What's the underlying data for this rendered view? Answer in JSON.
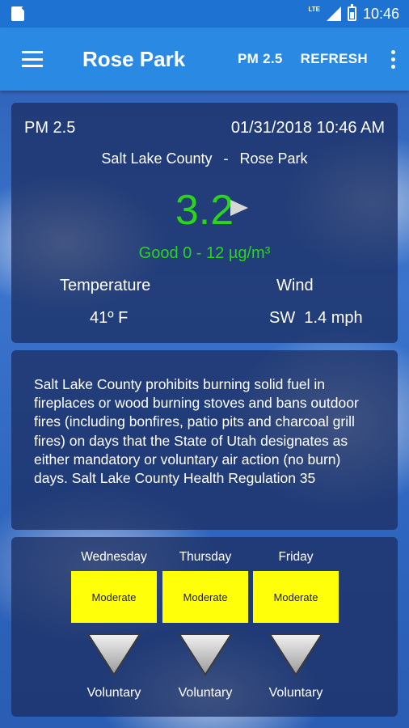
{
  "status_bar": {
    "network": "LTE",
    "time": "10:46"
  },
  "app_bar": {
    "title": "Rose Park",
    "actions": [
      "PM 2.5",
      "REFRESH"
    ]
  },
  "reading": {
    "pollutant": "PM 2.5",
    "datetime": "01/31/2018 10:46 AM",
    "county": "Salt Lake County",
    "separator": "-",
    "station": "Rose Park",
    "value": "3.2",
    "category": "Good 0 - 12 µg/m³",
    "temperature_label": "Temperature",
    "temperature_value": "41º F",
    "wind_label": "Wind",
    "wind_value": "SW  1.4 mph",
    "colors": {
      "good": "#2ad51b"
    }
  },
  "notice": {
    "text": "Salt Lake County prohibits burning solid fuel in fireplaces or wood burning stoves and bans outdoor fires (including bonfires, patio pits and charcoal grill fires) on days that the State of Utah designates as either mandatory or voluntary air action (no burn) days. Salt Lake County Health Regulation 35"
  },
  "forecast": [
    {
      "day": "Wednesday",
      "level": "Moderate",
      "action": "Voluntary",
      "icon": "down-triangle-icon"
    },
    {
      "day": "Thursday",
      "level": "Moderate",
      "action": "Voluntary",
      "icon": "down-triangle-icon"
    },
    {
      "day": "Friday",
      "level": "Moderate",
      "action": "Voluntary",
      "icon": "down-triangle-icon"
    }
  ]
}
